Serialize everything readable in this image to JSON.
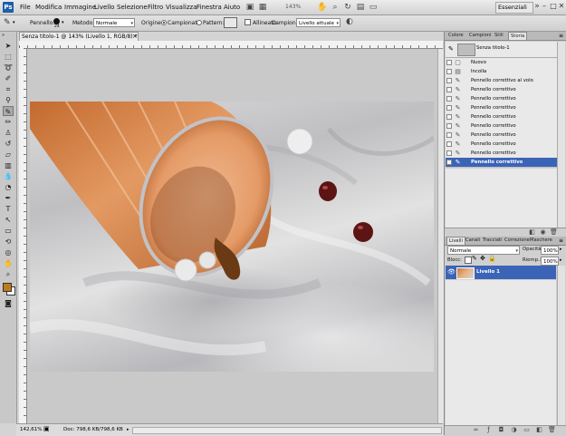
{
  "app": {
    "logo": "Ps",
    "menu": [
      "File",
      "Modifica",
      "Immagine",
      "Livello",
      "Selezione",
      "Filtro",
      "Visualizza",
      "Finestra",
      "Aiuto"
    ],
    "zoom": "143%",
    "workspace": "Essenziali",
    "window_buttons": [
      "–",
      "□",
      "✕"
    ]
  },
  "options": {
    "brush_label": "Pennello:",
    "brush_size": "24",
    "method_label": "Metodo:",
    "method_value": "Normale",
    "origin_label": "Origine:",
    "origin_sampled": "Campionato",
    "origin_pattern": "Pattern:",
    "aligned_label": "Allineato",
    "sample_label": "Campione:",
    "sample_value": "Livello attuale"
  },
  "document": {
    "tab_title": "Senza titolo-1 @ 143% (Livello 1, RGB/8) *",
    "close": "×",
    "status_zoom": "142,61%",
    "status_doc": "Doc: 798,6 KB/798,6 KB"
  },
  "history_panel": {
    "tabs": [
      "Colore",
      "Campioni",
      "Stili",
      "Storia"
    ],
    "active_tab": "Storia",
    "snapshot": "Senza titolo-1",
    "items": [
      "Nuovo",
      "Incolla",
      "Pennello correttivo al volo",
      "Pennello correttivo",
      "Pennello correttivo",
      "Pennello correttivo",
      "Pennello correttivo",
      "Pennello correttivo",
      "Pennello correttivo",
      "Pennello correttivo",
      "Pennello correttivo",
      "Pennello correttivo"
    ],
    "selected_index": 11
  },
  "layers_panel": {
    "tabs": [
      "Livelli",
      "Canali",
      "Tracciati",
      "Correzione",
      "Maschere"
    ],
    "active_tab": "Livelli",
    "blend_mode": "Normale",
    "opacity_label": "Opacità:",
    "opacity_value": "100%",
    "lock_label": "Blocc:",
    "fill_label": "Riemp.:",
    "fill_value": "100%",
    "layer_name": "Livello 1"
  },
  "colors": {
    "selection": "#3b64b7",
    "foreground": "#c07a1e",
    "background": "#ffffff"
  }
}
